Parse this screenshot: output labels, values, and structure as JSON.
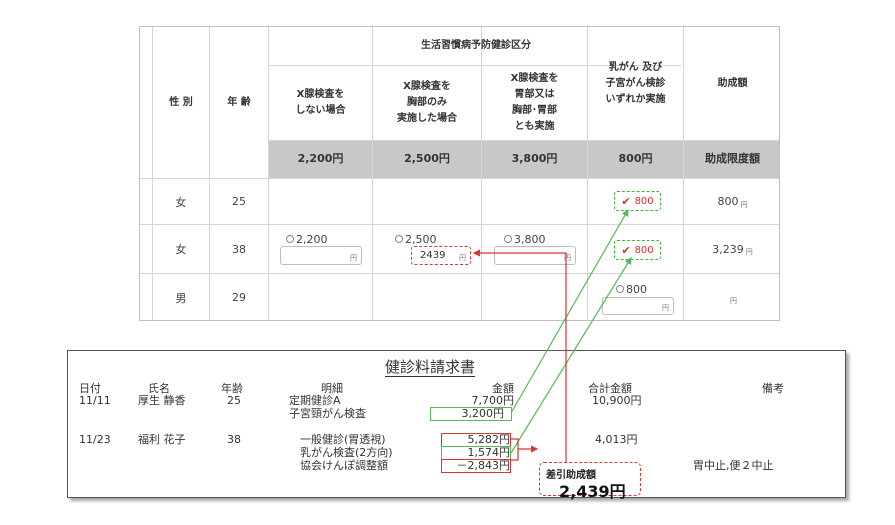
{
  "form": {
    "header": {
      "gender": "性 別",
      "age": "年 齢",
      "group_title": "生活習慣病予防健診区分",
      "col_no_xray": "X腺検査を\nしない場合",
      "col_chest": "X腺検査を\n胸部のみ\n実施した場合",
      "col_chest_stomach": "X腺検査を\n胃部又は\n胸部･胃部\nとも実施",
      "col_cancer": "乳がん 及び\n子宮がん検診\nいずれか実施",
      "col_subsidy": "助成額"
    },
    "prices": [
      "2,200円",
      "2,500円",
      "3,800円",
      "800円",
      "助成限度額"
    ],
    "rows": [
      {
        "gender": "女",
        "age": "25",
        "cancer_value": "800",
        "subsidy": "800",
        "yen": "円"
      },
      {
        "gender": "女",
        "age": "38",
        "opt1": "2,200",
        "opt2": "2,500",
        "opt2_value": "2439",
        "opt3": "3,800",
        "cancer_value": "800",
        "subsidy": "3,239",
        "yen": "円"
      },
      {
        "gender": "男",
        "age": "29",
        "cancer_opt": "800",
        "subsidy": "",
        "yen": "円"
      }
    ]
  },
  "invoice": {
    "title": "健診料請求書",
    "headers": {
      "date": "日付",
      "name": "氏名",
      "age": "年齢",
      "detail": "明細",
      "amount": "金額",
      "total": "合計金額",
      "remarks": "備考"
    },
    "entries": [
      {
        "date": "11/11",
        "name": "厚生 静香",
        "age": "25",
        "total": "10,900円",
        "remarks": "",
        "lines": [
          {
            "detail": "定期健診A",
            "amount": "7,700円"
          },
          {
            "detail": "子宮頸がん検査",
            "amount": "3,200円"
          }
        ]
      },
      {
        "date": "11/23",
        "name": "福利 花子",
        "age": "38",
        "total": "4,013円",
        "remarks": "胃中止,便２中止",
        "lines": [
          {
            "detail": "一般健診(胃透視)",
            "amount": "5,282円"
          },
          {
            "detail": "乳がん検査(2方向)",
            "amount": "1,574円"
          },
          {
            "detail": "協会けんぽ調整額",
            "amount": "－2,843円"
          }
        ]
      }
    ],
    "callout": {
      "label": "差引助成額",
      "value": "2,439円"
    }
  },
  "colors": {
    "green": "#58b858",
    "red": "#dd3333",
    "header_band": "#c8c8c8"
  }
}
